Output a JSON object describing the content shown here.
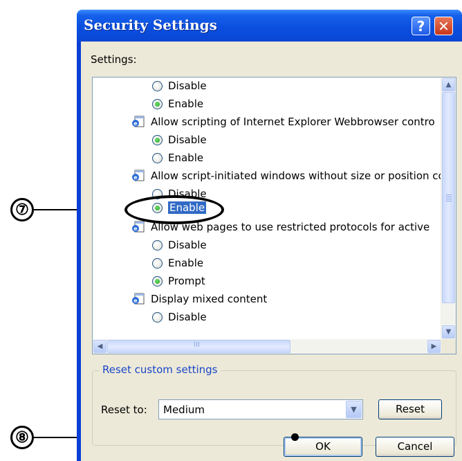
{
  "dialog": {
    "title": "Security Settings",
    "help_icon": "help-question-icon",
    "close_icon": "close-x-icon"
  },
  "settings_label": "Settings:",
  "settings_list": {
    "items": [
      {
        "type": "radio",
        "label": "Disable",
        "checked": false
      },
      {
        "type": "radio",
        "label": "Enable",
        "checked": true
      },
      {
        "type": "header",
        "label": "Allow scripting of Internet Explorer Webbrowser contro"
      },
      {
        "type": "radio",
        "label": "Disable",
        "checked": true
      },
      {
        "type": "radio",
        "label": "Enable",
        "checked": false
      },
      {
        "type": "header",
        "label": "Allow script-initiated windows without size or position co"
      },
      {
        "type": "radio",
        "label": "Disable",
        "checked": false
      },
      {
        "type": "radio",
        "label": "Enable",
        "checked": true,
        "selected": true
      },
      {
        "type": "header",
        "label": "Allow web pages to use restricted protocols for active"
      },
      {
        "type": "radio",
        "label": "Disable",
        "checked": false
      },
      {
        "type": "radio",
        "label": "Enable",
        "checked": false
      },
      {
        "type": "radio",
        "label": "Prompt",
        "checked": true
      },
      {
        "type": "header",
        "label": "Display mixed content"
      },
      {
        "type": "radio",
        "label": "Disable",
        "checked": false
      }
    ],
    "scroll_up_icon": "scroll-up-arrow-icon",
    "scroll_down_icon": "scroll-down-arrow-icon",
    "scroll_left_icon": "scroll-left-arrow-icon",
    "scroll_right_icon": "scroll-right-arrow-icon",
    "thumb_grip": "III"
  },
  "reset_group": {
    "legend": "Reset custom settings",
    "reset_to_label": "Reset to:",
    "combo_value": "Medium",
    "reset_button": "Reset"
  },
  "buttons": {
    "ok": "OK",
    "cancel": "Cancel"
  },
  "callouts": {
    "seven": "⑦",
    "eight": "⑧"
  },
  "colors": {
    "titlebar": "#0a4fe0",
    "selection": "#316ac5",
    "group_legend": "#1a45c8",
    "dialog_face": "#ece9d8"
  }
}
